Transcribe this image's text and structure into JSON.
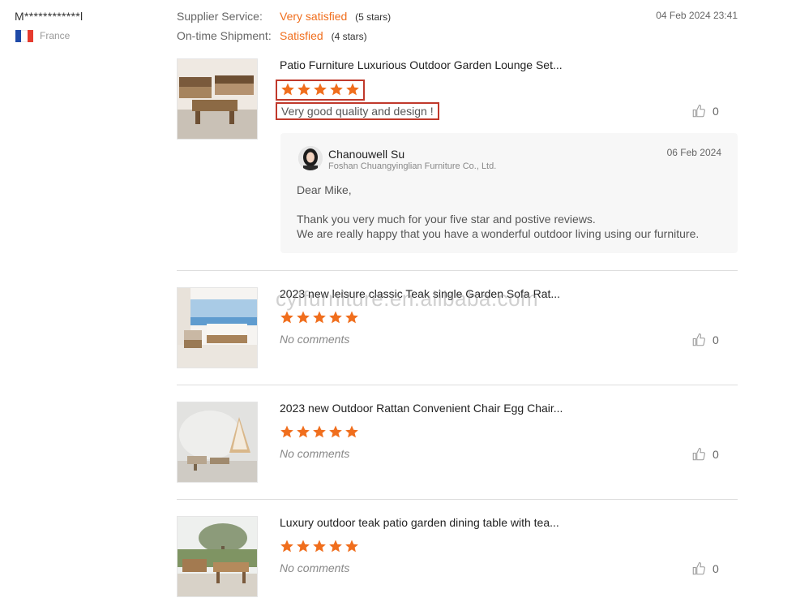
{
  "reviewer": {
    "name": "M************l",
    "country": "France",
    "flag_colors": [
      "#1f4aa8",
      "#ffffff",
      "#e63b2e"
    ]
  },
  "ratings": [
    {
      "label": "Supplier Service:",
      "value": "Very satisfied",
      "stars": "(5 stars)"
    },
    {
      "label": "On-time Shipment:",
      "value": "Satisfied",
      "stars": "(4 stars)"
    }
  ],
  "review_date": "04 Feb 2024 23:41",
  "accent_color": "#f06e1d",
  "highlight_color": "#c0392b",
  "products": [
    {
      "title": "Patio Furniture Luxurious Outdoor Garden Lounge Set...",
      "rating": 5,
      "comment": "Very good quality and design !",
      "likes": "0",
      "reply": {
        "name": "Chanouwell Su",
        "company": "Foshan Chuangyinglian Furniture Co., Ltd.",
        "date": "06 Feb 2024",
        "greeting": "Dear Mike,",
        "line1": "Thank you very much for your five star and postive reviews.",
        "line2": "We are really happy that you have a wonderful outdoor living using our furniture."
      }
    },
    {
      "title": "2023 new leisure classic Teak single Garden Sofa Rat...",
      "rating": 5,
      "comment": "No comments",
      "likes": "0"
    },
    {
      "title": "2023 new Outdoor Rattan Convenient Chair Egg Chair...",
      "rating": 5,
      "comment": "No comments",
      "likes": "0"
    },
    {
      "title": "Luxury outdoor teak patio garden dining table with tea...",
      "rating": 5,
      "comment": "No comments",
      "likes": "0"
    }
  ],
  "watermark": "cylfurniture.en.alibaba.com"
}
